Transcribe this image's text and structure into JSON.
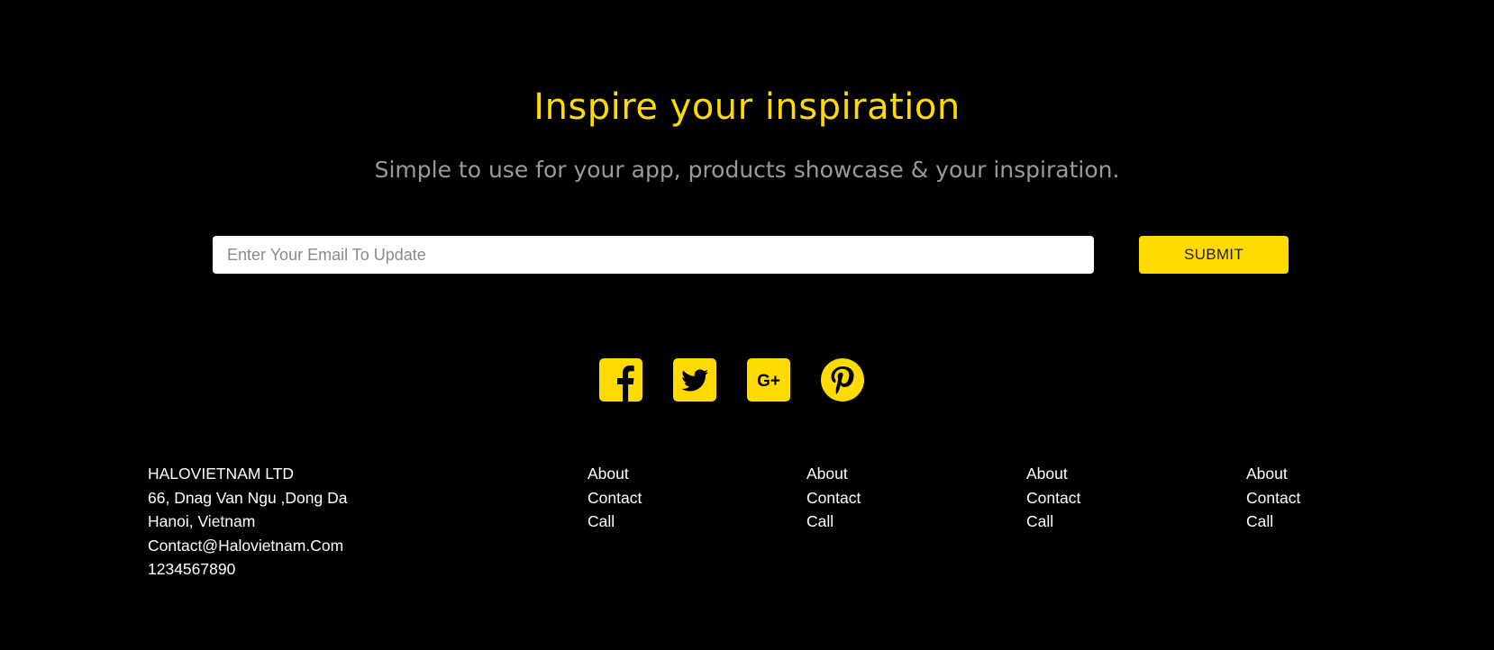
{
  "hero": {
    "title": "Inspire your inspiration",
    "subtitle": "Simple to use for your app, products showcase & your inspiration."
  },
  "newsletter": {
    "email_placeholder": "Enter Your Email To Update",
    "email_value": "",
    "submit_label": "SUBMIT"
  },
  "social": {
    "accent_color": "#ffdb00",
    "icons": [
      "facebook-icon",
      "twitter-icon",
      "google-plus-icon",
      "pinterest-icon"
    ],
    "google_plus_text": "G+"
  },
  "company": {
    "name": "HALOVIETNAM LTD",
    "address_line1": "66, Dnag Van Ngu ,Dong Da",
    "address_line2": "Hanoi, Vietnam",
    "email": "Contact@Halovietnam.Com",
    "phone": "1234567890"
  },
  "link_columns": [
    {
      "items": [
        "About",
        "Contact",
        "Call"
      ]
    },
    {
      "items": [
        "About",
        "Contact",
        "Call"
      ]
    },
    {
      "items": [
        "About",
        "Contact",
        "Call"
      ]
    },
    {
      "items": [
        "About",
        "Contact",
        "Call"
      ]
    }
  ],
  "colors": {
    "background": "#000000",
    "accent": "#ffdb00",
    "subtitle": "#9a9a9a",
    "text": "#ffffff"
  }
}
